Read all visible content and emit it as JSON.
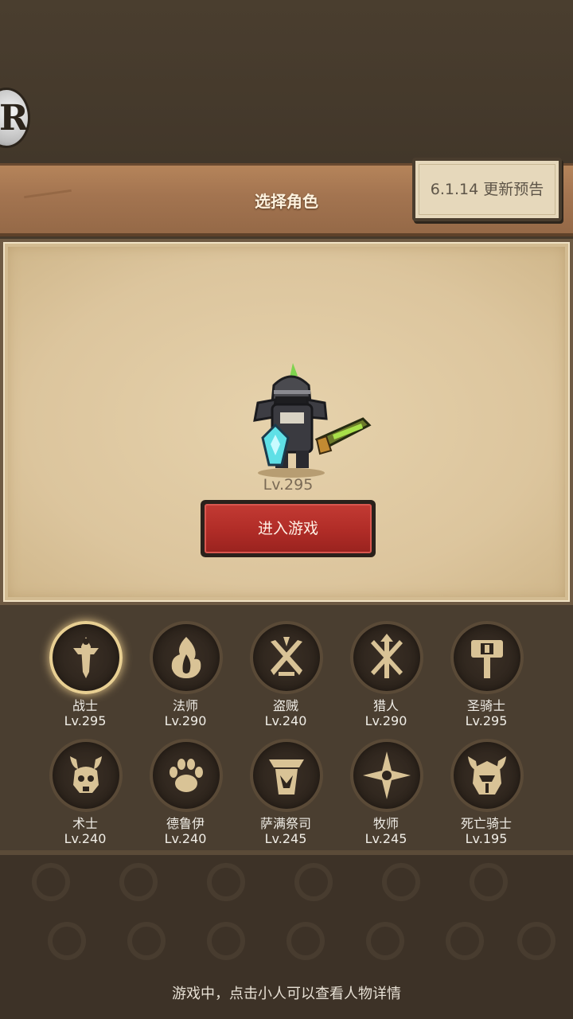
{
  "header": {
    "title": "选择角色",
    "update_notice": "6.1.14 更新预告",
    "logo_letter": "R"
  },
  "preview": {
    "level": "Lv.295",
    "enter_button": "进入游戏"
  },
  "classes": [
    {
      "name": "战士",
      "level": "Lv.295",
      "icon": "sword-icon",
      "selected": true
    },
    {
      "name": "法师",
      "level": "Lv.290",
      "icon": "flame-icon",
      "selected": false
    },
    {
      "name": "盗贼",
      "level": "Lv.240",
      "icon": "crossed-daggers-icon",
      "selected": false
    },
    {
      "name": "猎人",
      "level": "Lv.290",
      "icon": "crossed-arrows-icon",
      "selected": false
    },
    {
      "name": "圣骑士",
      "level": "Lv.295",
      "icon": "hammer-icon",
      "selected": false
    },
    {
      "name": "术士",
      "level": "Lv.240",
      "icon": "demon-skull-icon",
      "selected": false
    },
    {
      "name": "德鲁伊",
      "level": "Lv.240",
      "icon": "paw-icon",
      "selected": false
    },
    {
      "name": "萨满祭司",
      "level": "Lv.245",
      "icon": "totem-icon",
      "selected": false
    },
    {
      "name": "牧师",
      "level": "Lv.245",
      "icon": "holy-star-icon",
      "selected": false
    },
    {
      "name": "死亡骑士",
      "level": "Lv.195",
      "icon": "horned-helm-icon",
      "selected": false
    }
  ],
  "footer": {
    "hint": "游戏中，点击小人可以查看人物详情"
  },
  "colors": {
    "background": "#45392a",
    "title_bar": "#a37450",
    "enter_button": "#b02c27",
    "emblem_gold": "#d9c396",
    "selected_glow": "#e8cf92"
  }
}
